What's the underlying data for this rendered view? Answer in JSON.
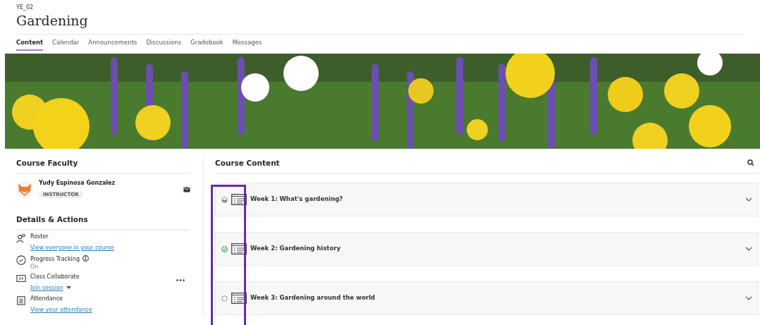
{
  "course": {
    "code": "YE_02",
    "title": "Gardening"
  },
  "tabs": [
    {
      "label": "Content",
      "selected": true
    },
    {
      "label": "Calendar",
      "selected": false
    },
    {
      "label": "Announcements",
      "selected": false
    },
    {
      "label": "Discussions",
      "selected": false
    },
    {
      "label": "Gradebook",
      "selected": false
    },
    {
      "label": "Messages",
      "selected": false
    }
  ],
  "faculty": {
    "heading": "Course Faculty",
    "name": "Yudy Espinosa Gonzalez",
    "role": "INSTRUCTOR"
  },
  "details": {
    "heading": "Details & Actions",
    "items": [
      {
        "kind": "roster",
        "title": "Roster",
        "link": "View everyone in your course"
      },
      {
        "kind": "progress",
        "title": "Progress Tracking",
        "status": "On"
      },
      {
        "kind": "collaborate",
        "title": "Class Collaborate",
        "link": "Join session"
      },
      {
        "kind": "attendance",
        "title": "Attendance",
        "link": "View your attendance"
      }
    ]
  },
  "content": {
    "heading": "Course Content",
    "items": [
      {
        "title": "Week 1: What's gardening?",
        "started": true,
        "completed": false
      },
      {
        "title": "Week 2: Gardening history",
        "started": true,
        "completed": true
      },
      {
        "title": "Week 3: Gardening around the world",
        "started": false,
        "completed": false
      }
    ]
  }
}
